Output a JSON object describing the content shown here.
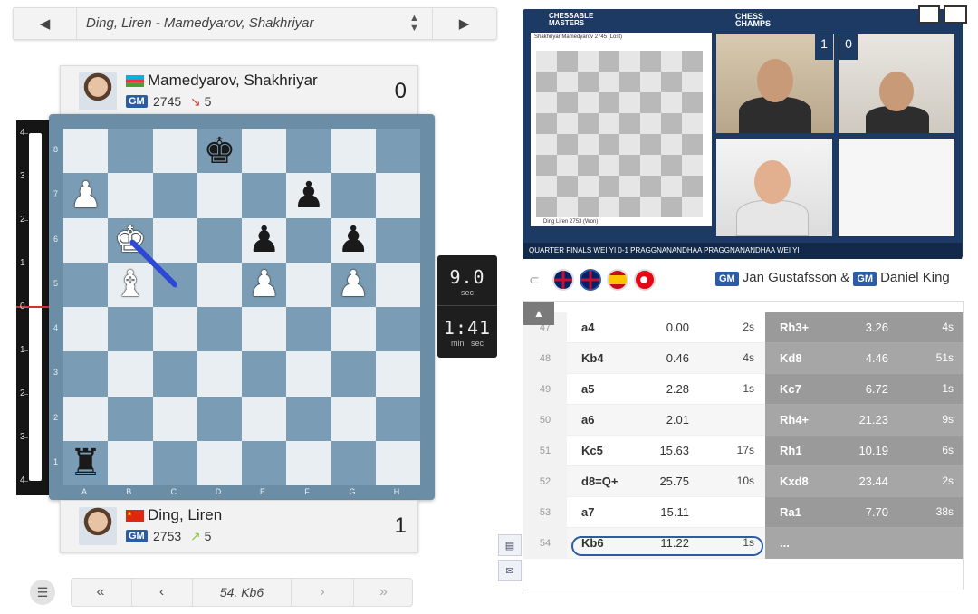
{
  "game_selector": {
    "title": "Ding, Liren - Mamedyarov, Shakhriyar",
    "prev_icon": "arrow-left-icon",
    "next_icon": "arrow-right-icon",
    "toggle_icon": "up-down-arrows-icon"
  },
  "top_player": {
    "name": "Mamedyarov, Shakhriyar",
    "title": "GM",
    "rating": "2745",
    "delta": "5",
    "delta_arrow": "↘",
    "delta_color": "#d9423a",
    "score": "0",
    "flag": "azerbaijan"
  },
  "bottom_player": {
    "name": "Ding, Liren",
    "title": "GM",
    "rating": "2753",
    "delta": "5",
    "delta_arrow": "↗",
    "delta_color": "#8cc63f",
    "score": "1",
    "flag": "china"
  },
  "eval_bar": {
    "labels": [
      "4",
      "3",
      "2",
      "1",
      "0",
      "1",
      "2",
      "3",
      "4"
    ]
  },
  "board": {
    "files": [
      "A",
      "B",
      "C",
      "D",
      "E",
      "F",
      "G",
      "H"
    ],
    "ranks": [
      "8",
      "7",
      "6",
      "5",
      "4",
      "3",
      "2",
      "1"
    ],
    "pieces": [
      {
        "square": "d8",
        "color": "b",
        "glyph": "♚",
        "name": "black-king"
      },
      {
        "square": "a7",
        "color": "w",
        "glyph": "♟",
        "name": "white-pawn"
      },
      {
        "square": "f7",
        "color": "b",
        "glyph": "♟",
        "name": "black-pawn"
      },
      {
        "square": "b6",
        "color": "w",
        "glyph": "♚",
        "name": "white-king"
      },
      {
        "square": "e6",
        "color": "b",
        "glyph": "♟",
        "name": "black-pawn"
      },
      {
        "square": "g6",
        "color": "b",
        "glyph": "♟",
        "name": "black-pawn"
      },
      {
        "square": "b5",
        "color": "w",
        "glyph": "♝",
        "name": "white-bishop"
      },
      {
        "square": "e5",
        "color": "w",
        "glyph": "♟",
        "name": "white-pawn"
      },
      {
        "square": "g5",
        "color": "w",
        "glyph": "♟",
        "name": "white-pawn"
      },
      {
        "square": "a1",
        "color": "b",
        "glyph": "♜",
        "name": "black-rook"
      }
    ],
    "last_move_arrow": {
      "from": "c5",
      "to": "b6",
      "color": "#2d47d6"
    }
  },
  "clock": {
    "move_time": "9.0",
    "move_time_unit": "sec",
    "total_time": "1:41",
    "total_unit_min": "min",
    "total_unit_sec": "sec"
  },
  "move_nav": {
    "current_move": "54. Kb6",
    "first_icon": "double-chevron-left-icon",
    "prev_icon": "chevron-left-icon",
    "next_icon": "chevron-right-icon",
    "last_icon": "double-chevron-right-icon",
    "menu_icon": "menu-icon"
  },
  "video": {
    "logo_left": "CHESSABLE MASTERS",
    "logo_right": "CHESS CHAMPS",
    "mini_board_top_player": "Shakhriyar Mamedyarov 2745 (Lost)",
    "mini_board_bottom_player": "Ding Liren 2753 (Won)",
    "score_left": "1",
    "score_right": "0",
    "ticker": "QUARTER FINALS   WEI YI 0-1 PRAGGNANANDHAA   PRAGGNANANDHAA WEI YI"
  },
  "commentary": {
    "language_flags": [
      "uk",
      "uk",
      "spain",
      "turkey"
    ],
    "commentator_1": "Jan Gustafsson",
    "commentator_2": "Daniel King",
    "title": "GM",
    "joiner": "&"
  },
  "moves_table": {
    "rows": [
      {
        "num": "47",
        "white": "a4",
        "white_eval": "0.00",
        "white_time": "2s",
        "black": "Rh3+",
        "black_eval": "3.26",
        "black_time": "4s"
      },
      {
        "num": "48",
        "white": "Kb4",
        "white_eval": "0.46",
        "white_time": "4s",
        "black": "Kd8",
        "black_eval": "4.46",
        "black_time": "51s"
      },
      {
        "num": "49",
        "white": "a5",
        "white_eval": "2.28",
        "white_time": "1s",
        "black": "Kc7",
        "black_eval": "6.72",
        "black_time": "1s"
      },
      {
        "num": "50",
        "white": "a6",
        "white_eval": "2.01",
        "white_time": "",
        "black": "Rh4+",
        "black_eval": "21.23",
        "black_time": "9s"
      },
      {
        "num": "51",
        "white": "Kc5",
        "white_eval": "15.63",
        "white_time": "17s",
        "black": "Rh1",
        "black_eval": "10.19",
        "black_time": "6s"
      },
      {
        "num": "52",
        "white": "d8=Q+",
        "white_eval": "25.75",
        "white_time": "10s",
        "black": "Kxd8",
        "black_eval": "23.44",
        "black_time": "2s"
      },
      {
        "num": "53",
        "white": "a7",
        "white_eval": "15.11",
        "white_time": "",
        "black": "Ra1",
        "black_eval": "7.70",
        "black_time": "38s"
      },
      {
        "num": "54",
        "white": "Kb6",
        "white_eval": "11.22",
        "white_time": "1s",
        "black": "...",
        "black_eval": "",
        "black_time": ""
      }
    ]
  }
}
